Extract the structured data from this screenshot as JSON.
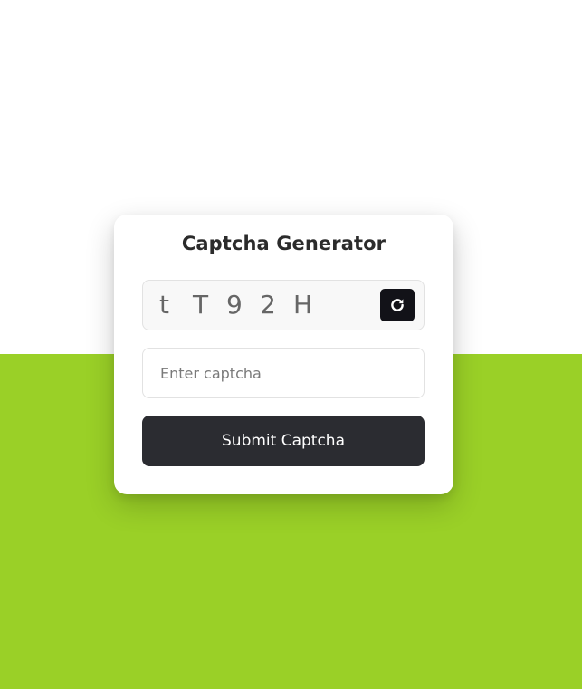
{
  "page": {
    "background_top_color": "#ffffff",
    "background_bottom_color": "#9ad027"
  },
  "card": {
    "title": "Captcha Generator",
    "captcha": {
      "chars": [
        "t",
        "T",
        "9",
        "2",
        "H"
      ],
      "refresh_icon": "refresh-icon"
    },
    "input": {
      "value": "",
      "placeholder": "Enter captcha"
    },
    "submit_label": "Submit Captcha"
  }
}
